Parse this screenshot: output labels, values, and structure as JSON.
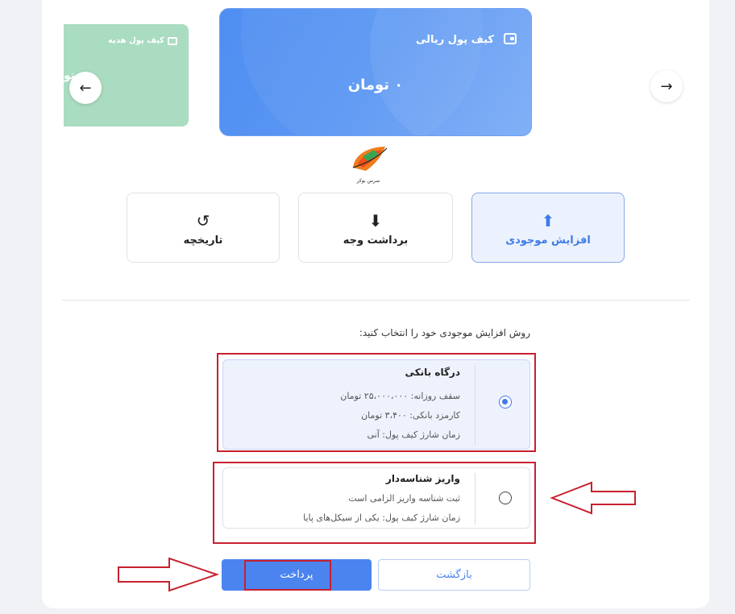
{
  "carousel": {
    "main_card": {
      "title": "کیف پول ریالی",
      "amount": "۰ تومان",
      "icon": "wallet-icon"
    },
    "side_card": {
      "title": "کیف پول هدیه",
      "cut_text": "تو",
      "icon": "gift-icon"
    },
    "prev_symbol": "←",
    "next_symbol": "→"
  },
  "logo": {
    "caption": "سرس بوکر"
  },
  "actions": [
    {
      "label": "افزایش موجودی",
      "icon": "upload-icon",
      "glyph": "⬆",
      "active": true
    },
    {
      "label": "برداشت وجه",
      "icon": "download-icon",
      "glyph": "⬇",
      "active": false
    },
    {
      "label": "تاریخچه",
      "icon": "history-icon",
      "glyph": "↺",
      "active": false
    }
  ],
  "method_prompt": "روش افزایش موجودی خود را انتخاب کنید:",
  "options": [
    {
      "title": "درگاه بانکی",
      "lines": [
        "سقف روزانه: ۲۵،۰۰۰،۰۰۰ تومان",
        "کارمزد بانکی: ۳،۴۰۰ تومان",
        "زمان شارژ کیف پول: آنی"
      ],
      "selected": true
    },
    {
      "title": "واریز شناسه‌دار",
      "lines": [
        "ثبت شناسه واریز الزامی است",
        "زمان شارژ کیف پول: یکی از سیکل‌های پایا"
      ],
      "selected": false
    }
  ],
  "buttons": {
    "pay": "پرداخت",
    "back": "بازگشت"
  },
  "colors": {
    "accent": "#4b84ee",
    "annotation": "#c8202f",
    "gift_card": "#a9dcc0"
  }
}
